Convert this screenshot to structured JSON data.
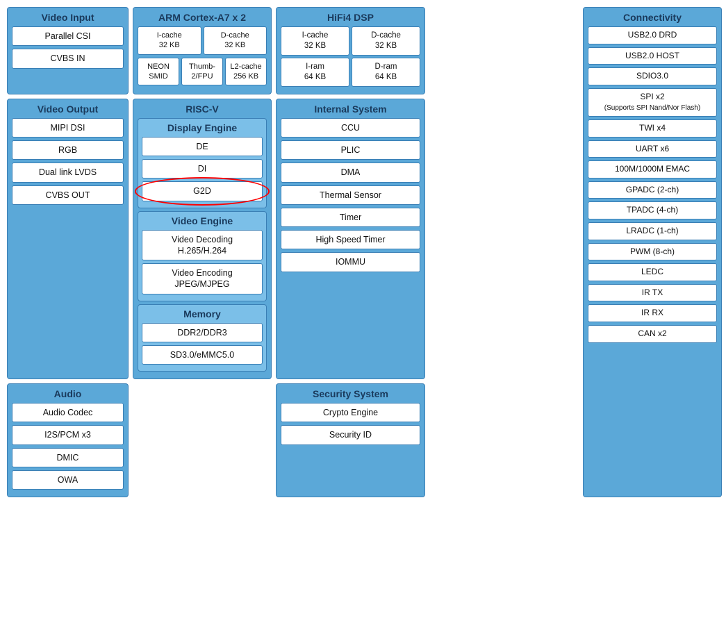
{
  "blocks": {
    "video_input": {
      "title": "Video Input",
      "items": [
        "Parallel CSI",
        "CVBS IN"
      ]
    },
    "arm_cortex": {
      "title": "ARM Cortex-A7 x 2",
      "cache_row1": [
        {
          "label": "I-cache\n32 KB"
        },
        {
          "label": "D-cache\n32 KB"
        }
      ],
      "cache_row2": [
        {
          "label": "NEON\nSMID"
        },
        {
          "label": "Thumb-\n2/FPU"
        },
        {
          "label": "L2-cache\n256 KB"
        }
      ]
    },
    "hifi4": {
      "title": "HiFi4 DSP",
      "cache": [
        {
          "label": "I-cache\n32 KB"
        },
        {
          "label": "D-cache\n32 KB"
        },
        {
          "label": "I-ram\n64 KB"
        },
        {
          "label": "D-ram\n64 KB"
        }
      ]
    },
    "connectivity": {
      "title": "Connectivity",
      "items": [
        "USB2.0 DRD",
        "USB2.0 HOST",
        "SDIO3.0",
        "SPI x2",
        "(Supports SPI Nand/Nor Flash)",
        "TWI x4",
        "UART x6",
        "100M/1000M EMAC",
        "GPADC (2-ch)",
        "TPADC (4-ch)",
        "LRADC (1-ch)",
        "PWM (8-ch)",
        "LEDC",
        "IR TX",
        "IR RX",
        "CAN x2"
      ]
    },
    "video_output": {
      "title": "Video Output",
      "items": [
        "MIPI DSI",
        "RGB",
        "Dual link LVDS",
        "CVBS OUT"
      ]
    },
    "risc_v": {
      "title": "RISC-V"
    },
    "display_engine": {
      "title": "Display Engine",
      "items": [
        "DE",
        "DI",
        "G2D"
      ]
    },
    "video_engine": {
      "title": "Video Engine",
      "items": [
        "Video Decoding\nH.265/H.264",
        "Video Encoding\nJPEG/MJPEG"
      ]
    },
    "memory": {
      "title": "Memory",
      "items": [
        "DDR2/DDR3",
        "SD3.0/eMMC5.0"
      ]
    },
    "internal_system": {
      "title": "Internal System",
      "items": [
        "CCU",
        "PLIC",
        "DMA",
        "Thermal Sensor",
        "Timer",
        "High Speed Timer",
        "IOMMU"
      ]
    },
    "security_system": {
      "title": "Security System",
      "items": [
        "Crypto Engine",
        "Security ID"
      ]
    }
  }
}
